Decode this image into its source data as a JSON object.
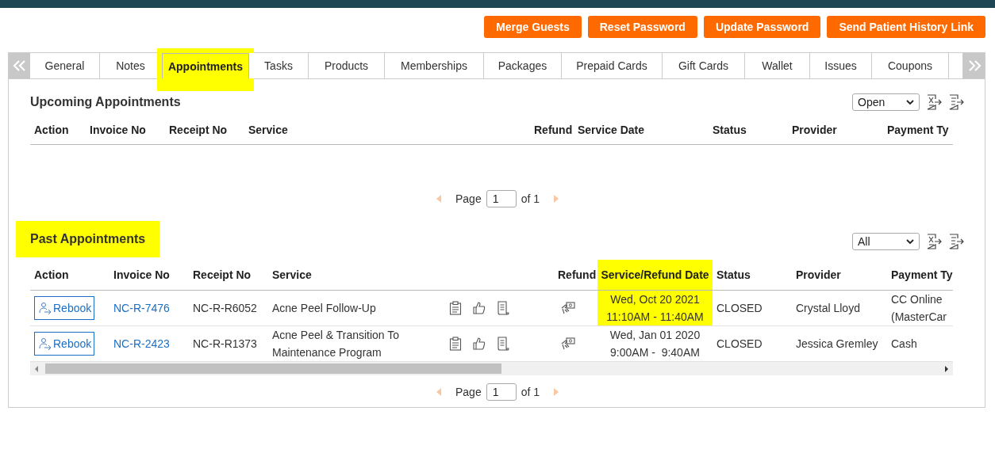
{
  "header_buttons": [
    "Merge Guests",
    "Reset Password",
    "Update Password",
    "Send Patient History Link"
  ],
  "tabs": [
    {
      "label": "General",
      "selected": false,
      "highlighted": false
    },
    {
      "label": "Notes",
      "selected": false,
      "highlighted": false
    },
    {
      "label": "Appointments",
      "selected": true,
      "highlighted": true
    },
    {
      "label": "Tasks",
      "selected": false,
      "highlighted": false
    },
    {
      "label": "Products",
      "selected": false,
      "highlighted": false
    },
    {
      "label": "Memberships",
      "selected": false,
      "highlighted": false
    },
    {
      "label": "Packages",
      "selected": false,
      "highlighted": false
    },
    {
      "label": "Prepaid Cards",
      "selected": false,
      "highlighted": false
    },
    {
      "label": "Gift Cards",
      "selected": false,
      "highlighted": false
    },
    {
      "label": "Wallet",
      "selected": false,
      "highlighted": false
    },
    {
      "label": "Issues",
      "selected": false,
      "highlighted": false
    },
    {
      "label": "Coupons",
      "selected": false,
      "highlighted": false
    }
  ],
  "upcoming": {
    "title": "Upcoming Appointments",
    "highlighted": false,
    "filter": "Open",
    "columns": [
      {
        "label": "Action",
        "highlighted": false
      },
      {
        "label": "Invoice No",
        "highlighted": false
      },
      {
        "label": "Receipt No",
        "highlighted": false
      },
      {
        "label": "Service",
        "highlighted": false
      },
      {
        "label": "Refund",
        "highlighted": false
      },
      {
        "label": "Service Date",
        "highlighted": false
      },
      {
        "label": "Status",
        "highlighted": false
      },
      {
        "label": "Provider",
        "highlighted": false
      },
      {
        "label": "Payment Ty",
        "highlighted": false
      }
    ],
    "pager": {
      "label": "Page",
      "page": "1",
      "total": "of 1"
    }
  },
  "past": {
    "title": "Past Appointments",
    "highlighted": true,
    "filter": "All",
    "columns": [
      {
        "label": "Action",
        "highlighted": false
      },
      {
        "label": "Invoice No",
        "highlighted": false
      },
      {
        "label": "Receipt No",
        "highlighted": false
      },
      {
        "label": "Service",
        "highlighted": false
      },
      {
        "label": "Refund",
        "highlighted": false
      },
      {
        "label": "Service/Refund Date",
        "highlighted": true
      },
      {
        "label": "Status",
        "highlighted": false
      },
      {
        "label": "Provider",
        "highlighted": false
      },
      {
        "label": "Payment Ty",
        "highlighted": false
      }
    ],
    "rows": [
      {
        "action": "Rebook",
        "invoice": "NC-R-7476",
        "receipt": "NC-R-R6052",
        "service": "Acne Peel Follow-Up",
        "date": "Wed, Oct 20 2021",
        "time": "11:10AM - 11:40AM",
        "date_highlighted": true,
        "status": "CLOSED",
        "provider": "Crystal Lloyd",
        "payment": "CC Online (MasterCar"
      },
      {
        "action": "Rebook",
        "invoice": "NC-R-2423",
        "receipt": "NC-R-R1373",
        "service": "Acne Peel & Transition To Maintenance Program",
        "date": "Wed, Jan 01 2020",
        "time": "9:00AM -  9:40AM",
        "date_highlighted": false,
        "status": "CLOSED",
        "provider": "Jessica Gremley",
        "payment": "Cash"
      }
    ],
    "pager": {
      "label": "Page",
      "page": "1",
      "total": "of 1"
    }
  }
}
